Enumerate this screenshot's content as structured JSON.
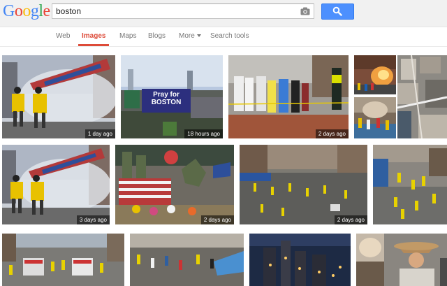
{
  "logo": {
    "letters": [
      "G",
      "o",
      "o",
      "g",
      "l",
      "e"
    ],
    "colors": [
      "#4285f4",
      "#ea4335",
      "#fbbc05",
      "#4285f4",
      "#34a853",
      "#ea4335"
    ]
  },
  "search": {
    "value": "boston",
    "placeholder": ""
  },
  "nav": {
    "web": "Web",
    "images": "Images",
    "maps": "Maps",
    "blogs": "Blogs",
    "more": "More",
    "search_tools": "Search tools"
  },
  "colors": {
    "accent": "#dd4b39",
    "button_blue": "#4d90fe"
  },
  "images": [
    {
      "caption": "1 day ago"
    },
    {
      "caption": "18 hours ago",
      "sign": "Pray for BOSTON"
    },
    {
      "caption": "2 days ago"
    },
    {
      "caption": ""
    },
    {
      "caption": ""
    },
    {
      "caption": "3 days ago"
    },
    {
      "caption": "2 days ago"
    },
    {
      "caption": "2 days ago"
    },
    {
      "caption": ""
    },
    {
      "caption": ""
    },
    {
      "caption": ""
    },
    {
      "caption": ""
    },
    {
      "caption": ""
    }
  ]
}
